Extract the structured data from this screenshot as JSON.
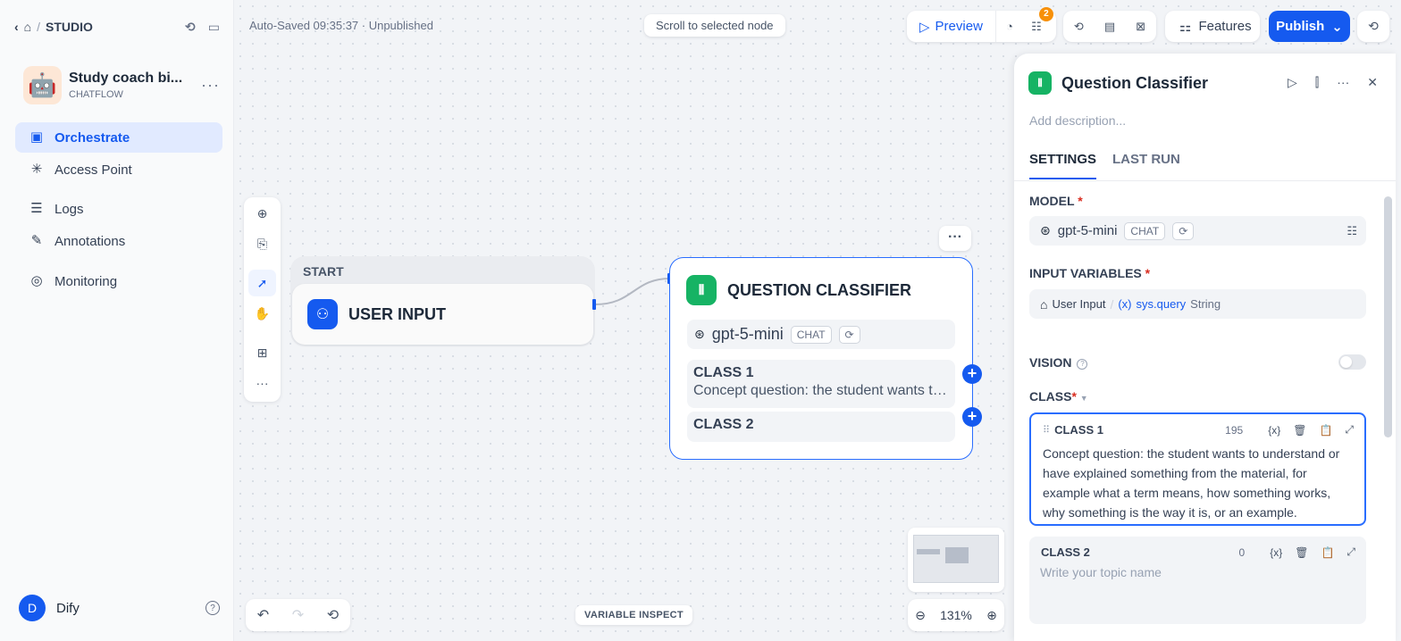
{
  "nav": {
    "section": "STUDIO"
  },
  "app": {
    "name": "Study coach bi...",
    "type": "CHATFLOW",
    "avatar": "🤖"
  },
  "sidebar": {
    "items": [
      {
        "label": "Orchestrate",
        "icon": "orchestrate-icon",
        "active": true
      },
      {
        "label": "Access Point",
        "icon": "access-point-icon"
      },
      {
        "label": "Logs",
        "icon": "logs-icon"
      },
      {
        "label": "Annotations",
        "icon": "annotations-icon"
      },
      {
        "label": "Monitoring",
        "icon": "monitoring-icon"
      }
    ]
  },
  "user": {
    "initial": "D",
    "name": "Dify"
  },
  "header": {
    "autosave": "Auto-Saved 09:35:37 · Unpublished",
    "scroll_hint": "Scroll to selected node",
    "preview_label": "Preview",
    "checklist_badge": "2",
    "features_label": "Features",
    "publish_label": "Publish"
  },
  "canvas": {
    "start_label": "START",
    "start_node_title": "USER INPUT",
    "qc_title": "QUESTION CLASSIFIER",
    "qc_model": "gpt-5-mini",
    "qc_model_tag": "CHAT",
    "classes": [
      {
        "name": "CLASS 1",
        "desc": "Concept question: the student wants to understand or have explained something from the material"
      },
      {
        "name": "CLASS 2",
        "desc": ""
      }
    ],
    "variable_inspect": "VARIABLE INSPECT",
    "zoom": "131%"
  },
  "panel": {
    "title": "Question Classifier",
    "description_placeholder": "Add description...",
    "tabs": [
      "SETTINGS",
      "LAST RUN"
    ],
    "model_label": "MODEL",
    "model_name": "gpt-5-mini",
    "model_tag": "CHAT",
    "input_vars_label": "INPUT VARIABLES",
    "input_var_source": "User Input",
    "input_var_name": "sys.query",
    "input_var_type": "String",
    "vision_label": "VISION",
    "vision_enabled": false,
    "class_label": "CLASS",
    "class1_name": "CLASS 1",
    "class1_count": "195",
    "class1_text": "Concept question: the student wants to understand or have explained something from the material, for example what a term means, how something works, why something is the way it is, or an example.",
    "class2_name": "CLASS 2",
    "class2_count": "0",
    "class2_placeholder": "Write your topic name"
  },
  "colors": {
    "accent": "#155aef",
    "node_green": "#16b364",
    "badge": "#f79009"
  }
}
